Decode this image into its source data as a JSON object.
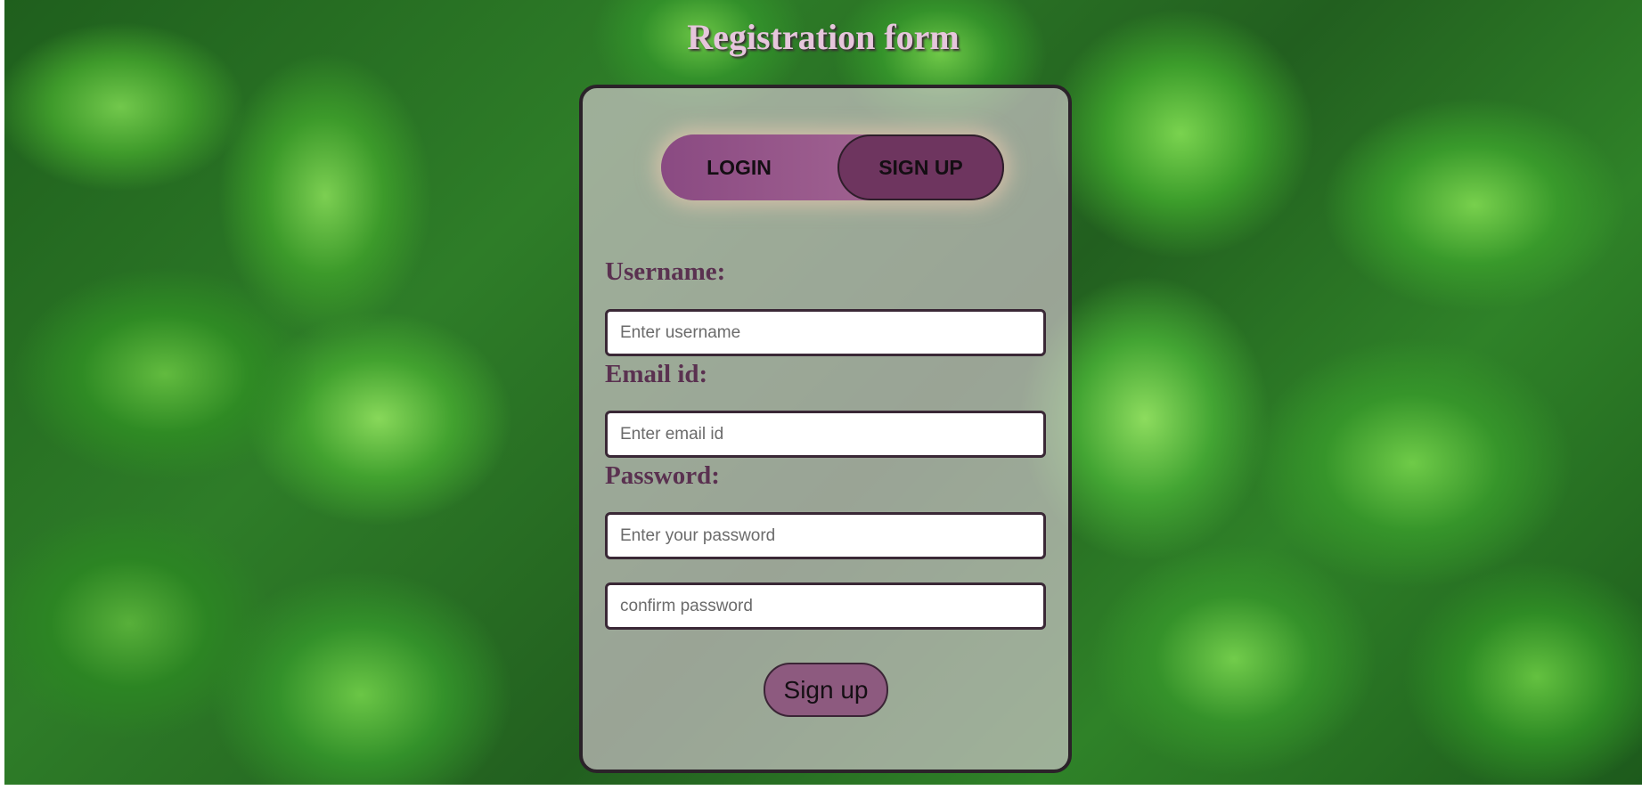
{
  "page": {
    "title": "Registration form"
  },
  "toggle": {
    "login_label": "LOGIN",
    "signup_label": "SIGN UP",
    "active": "SIGN UP"
  },
  "form": {
    "username": {
      "label": "Username:",
      "placeholder": "Enter username",
      "value": ""
    },
    "email": {
      "label": "Email id:",
      "placeholder": "Enter email id",
      "value": ""
    },
    "password": {
      "label": "Password:",
      "placeholder": "Enter your password",
      "value": ""
    },
    "confirm_password": {
      "placeholder": "confirm password",
      "value": ""
    },
    "submit_label": "Sign up"
  },
  "colors": {
    "card_background": "#e4cede",
    "toggle_active": "#6e355f",
    "toggle_track": "#8a4a82",
    "label_text": "#5a3150",
    "title_text": "#e6c6dc",
    "submit_button": "#8d5a7f",
    "background_leaves": "#2e7d28"
  }
}
